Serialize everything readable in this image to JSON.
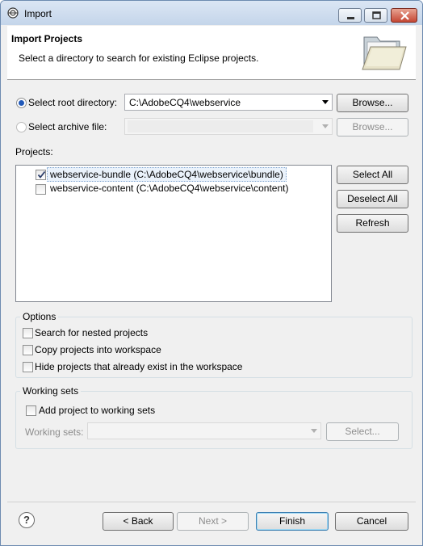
{
  "window": {
    "title": "Import"
  },
  "header": {
    "title": "Import Projects",
    "description": "Select a directory to search for existing Eclipse projects."
  },
  "source": {
    "root_radio_label": "Select root directory:",
    "root_path": "C:\\AdobeCQ4\\webservice",
    "root_browse_label": "Browse...",
    "archive_radio_label": "Select archive file:",
    "archive_path": "",
    "archive_browse_label": "Browse...",
    "selected": "root"
  },
  "projects": {
    "label": "Projects:",
    "items": [
      {
        "label": "webservice-bundle (C:\\AdobeCQ4\\webservice\\bundle)",
        "checked": true,
        "selected": true
      },
      {
        "label": "webservice-content (C:\\AdobeCQ4\\webservice\\content)",
        "checked": false,
        "selected": false
      }
    ],
    "select_all_label": "Select All",
    "deselect_all_label": "Deselect All",
    "refresh_label": "Refresh"
  },
  "options": {
    "title": "Options",
    "items": [
      {
        "label": "Search for nested projects",
        "checked": false
      },
      {
        "label": "Copy projects into workspace",
        "checked": false
      },
      {
        "label": "Hide projects that already exist in the workspace",
        "checked": false
      }
    ]
  },
  "working_sets": {
    "title": "Working sets",
    "add_label": "Add project to working sets",
    "add_checked": false,
    "sets_label": "Working sets:",
    "sets_value": "",
    "select_label": "Select..."
  },
  "footer": {
    "back_label": "< Back",
    "next_label": "Next >",
    "finish_label": "Finish",
    "cancel_label": "Cancel"
  }
}
